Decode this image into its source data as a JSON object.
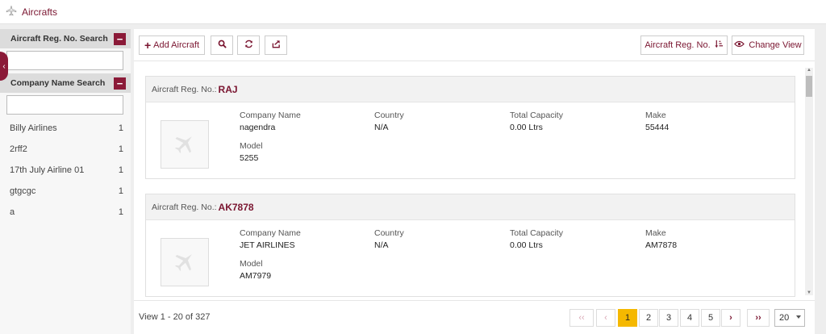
{
  "header": {
    "title": "Aircrafts",
    "icon": "airplane-icon"
  },
  "sidebar": {
    "reg_search_label": "Aircraft Reg. No. Search",
    "company_search_label": "Company Name Search",
    "collapse_symbol": "‹",
    "companies": [
      {
        "name": "Billy Airlines",
        "count": "1"
      },
      {
        "name": "2rff2",
        "count": "1"
      },
      {
        "name": "17th July Airline 01",
        "count": "1"
      },
      {
        "name": "gtgcgc",
        "count": "1"
      },
      {
        "name": "a",
        "count": "1"
      }
    ]
  },
  "toolbar": {
    "add_label": "Add Aircraft",
    "sort_label": "Aircraft Reg. No.",
    "change_view_label": "Change View"
  },
  "cards": [
    {
      "reg_label": "Aircraft Reg. No.:",
      "reg": "RAJ",
      "company_label": "Company Name",
      "company": "nagendra",
      "country_label": "Country",
      "country": "N/A",
      "capacity_label": "Total Capacity",
      "capacity": "0.00 Ltrs",
      "make_label": "Make",
      "make": "55444",
      "model_label": "Model",
      "model": "5255"
    },
    {
      "reg_label": "Aircraft Reg. No.:",
      "reg": "AK7878",
      "company_label": "Company Name",
      "company": "JET AIRLINES",
      "country_label": "Country",
      "country": "N/A",
      "capacity_label": "Total Capacity",
      "capacity": "0.00 Ltrs",
      "make_label": "Make",
      "make": "AM7878",
      "model_label": "Model",
      "model": "AM7979"
    }
  ],
  "pagination": {
    "info": "View 1 - 20 of 327",
    "first": "‹‹",
    "prev": "‹",
    "pages": [
      "1",
      "2",
      "3",
      "4",
      "5"
    ],
    "active_page": "1",
    "next": "›",
    "last": "››",
    "per_page": "20"
  },
  "colors": {
    "accent": "#7a1530",
    "active_page": "#f5b800"
  }
}
